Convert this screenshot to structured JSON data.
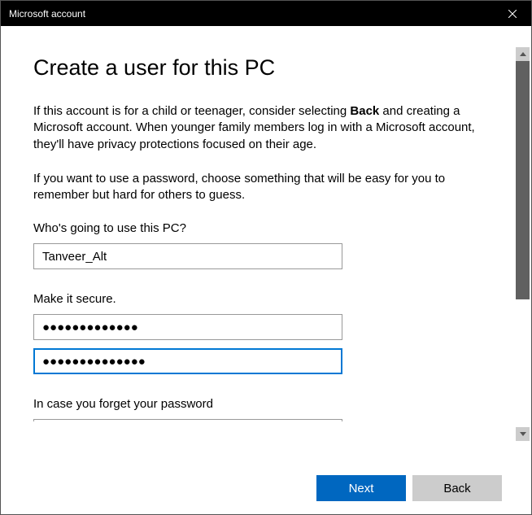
{
  "titlebar": {
    "title": "Microsoft account"
  },
  "main": {
    "heading": "Create a user for this PC",
    "paragraph1_pre": "If this account is for a child or teenager, consider selecting ",
    "paragraph1_bold": "Back",
    "paragraph1_post": " and creating a Microsoft account. When younger family members log in with a Microsoft account, they'll have privacy protections focused on their age.",
    "paragraph2": "If you want to use a password, choose something that will be easy for you to remember but hard for others to guess.",
    "label_user": "Who's going to use this PC?",
    "username_value": "Tanveer_Alt",
    "label_secure": "Make it secure.",
    "password_value": "●●●●●●●●●●●●●",
    "password_confirm_value": "●●●●●●●●●●●●●●",
    "label_forget": "In case you forget your password"
  },
  "footer": {
    "next_label": "Next",
    "back_label": "Back"
  }
}
